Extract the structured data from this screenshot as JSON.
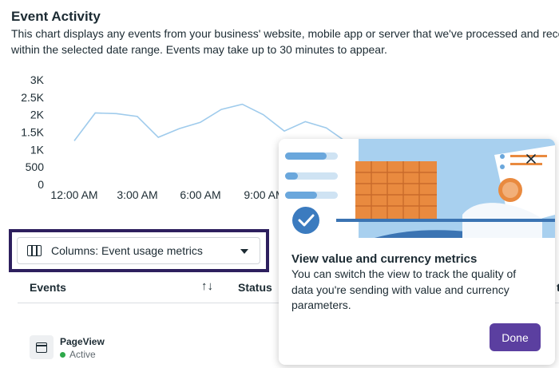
{
  "header": {
    "title": "Event Activity",
    "description_line1": "This chart displays any events from your business' website, mobile app or server that we've processed and rece",
    "description_line2": "within the selected date range. Events may take up to 30 minutes to appear."
  },
  "chart_data": {
    "type": "line",
    "y_ticks": [
      "3K",
      "2.5K",
      "2K",
      "1.5K",
      "1K",
      "500",
      "0"
    ],
    "x_ticks": [
      "12:00 AM",
      "3:00 AM",
      "6:00 AM",
      "9:00 AM"
    ],
    "ylim": [
      0,
      3000
    ],
    "series": [
      {
        "color": "#9fcbec",
        "values": [
          1250,
          2050,
          2030,
          1950,
          1350,
          1600,
          1780,
          2150,
          2300,
          2000,
          1530,
          1800,
          1620,
          1200
        ]
      }
    ]
  },
  "columns_dropdown": {
    "label": "Columns: Event usage metrics"
  },
  "table": {
    "headers": {
      "events": "Events",
      "sort": "↑↓",
      "status": "Status",
      "extra": "t"
    },
    "rows": [
      {
        "name": "PageView",
        "status": "Active"
      }
    ]
  },
  "popover": {
    "title": "View value and currency metrics",
    "body": "You can switch the view to track the quality of data you're sending with value and currency parameters.",
    "done_label": "Done",
    "colors": {
      "accent": "#5b3fa0",
      "illus_blue": "#4a88c5",
      "illus_light": "#cfe3f3",
      "illus_orange": "#e98a3f"
    }
  }
}
